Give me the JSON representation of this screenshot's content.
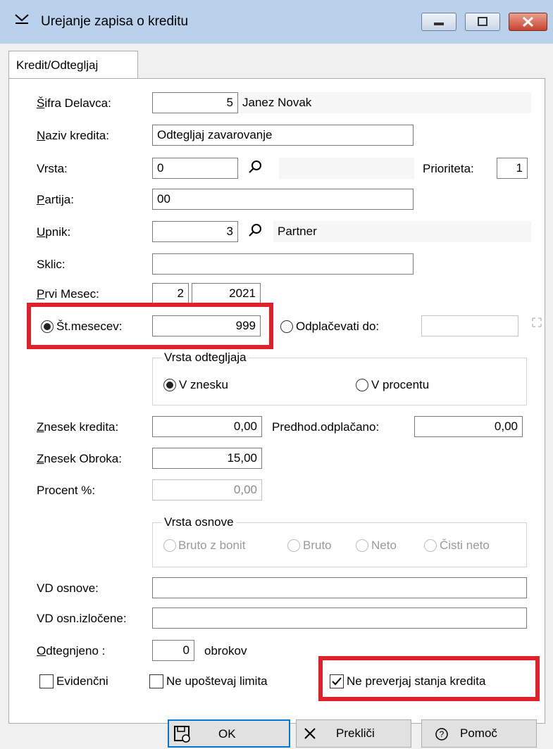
{
  "window": {
    "title": "Urejanje zapisa o kreditu",
    "minimize_glyph": "▁",
    "maximize_glyph": "▣",
    "close_glyph": "✕",
    "app_icon": "envelope-icon"
  },
  "tab": {
    "label": "Kredit/Odtegljaj"
  },
  "form": {
    "sifra_label": "Šifra Delavca:",
    "sifra_value": "5",
    "sifra_name": "Janez Novak",
    "naziv_label": "Naziv kredita:",
    "naziv_value": "Odtegljaj zavarovanje",
    "vrsta_label": "Vrsta:",
    "vrsta_value": "0",
    "prioriteta_label": "Prioriteta:",
    "prioriteta_value": "1",
    "partija_label": "Partija:",
    "partija_value": "00",
    "upnik_label": "Upnik:",
    "upnik_value": "3",
    "upnik_name": "Partner",
    "sklic_label": "Sklic:",
    "sklic_value": "",
    "prvi_mesec_label": "Prvi Mesec:",
    "prvi_mesec_month": "2",
    "prvi_mesec_year": "2021",
    "st_mesecev_label": "Št.mesecev:",
    "st_mesecev_value": "999",
    "st_mesecev_selected": true,
    "odplacevati_label": "Odplačevati do:",
    "odplacevati_value": "",
    "odplacevati_selected": false,
    "vrsta_odtegljaja": {
      "legend": "Vrsta odtegljaja",
      "opt1": "V znesku",
      "opt2": "V procentu",
      "selected": "V znesku"
    },
    "znesek_kredita_label": "Znesek kredita:",
    "znesek_kredita_value": "0,00",
    "predhod_label": "Predhod.odplačano:",
    "predhod_value": "0,00",
    "znesek_obroka_label": "Znesek Obroka:",
    "znesek_obroka_value": "15,00",
    "procent_label": "Procent %:",
    "procent_value": "0,00",
    "vrsta_osnove": {
      "legend": "Vrsta osnove",
      "opt1": "Bruto z bonit",
      "opt2": "Bruto",
      "opt3": "Neto",
      "opt4": "Čisti neto"
    },
    "vd_osnove_label": "VD osnove:",
    "vd_osnove_value": "",
    "vd_izlocene_label": "VD osn.izločene:",
    "vd_izlocene_value": "",
    "odtegnjeno_label": "Odtegnjeno :",
    "odtegnjeno_value": "0",
    "odtegnjeno_suffix": "obrokov",
    "evidencni_label": "Evidenčni",
    "evidencni_checked": false,
    "ne_upostevaj_label": "Ne upoštevaj limita",
    "ne_upostevaj_checked": false,
    "ne_preverjaj_label": "Ne preverjaj stanja kredita",
    "ne_preverjaj_checked": true
  },
  "buttons": {
    "ok": "OK",
    "preklici": "Prekliči",
    "pomoc": "Pomoč"
  },
  "colors": {
    "highlight": "#e0202a",
    "titlebar": "#b9d1ea",
    "default_button_border": "#0078d7"
  }
}
